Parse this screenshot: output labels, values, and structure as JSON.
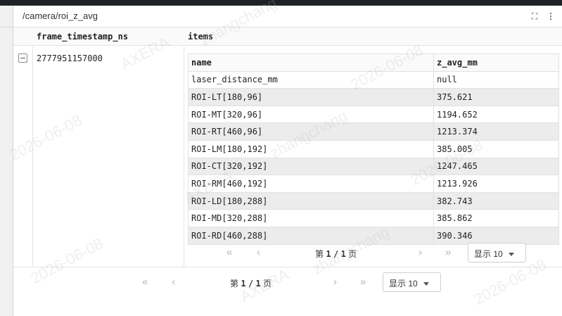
{
  "panel": {
    "title": "/camera/roi_z_avg"
  },
  "outer_table": {
    "columns": [
      "frame_timestamp_ns",
      "items"
    ],
    "row": {
      "frame_timestamp_ns": "2777951157000"
    }
  },
  "inner_table": {
    "columns": [
      "name",
      "z_avg_mm"
    ],
    "rows": [
      [
        "laser_distance_mm",
        "null"
      ],
      [
        "ROI-LT[180,96]",
        "375.621"
      ],
      [
        "ROI-MT[320,96]",
        "1194.652"
      ],
      [
        "ROI-RT[460,96]",
        "1213.374"
      ],
      [
        "ROI-LM[180,192]",
        "385.005"
      ],
      [
        "ROI-CT[320,192]",
        "1247.465"
      ],
      [
        "ROI-RM[460,192]",
        "1213.926"
      ],
      [
        "ROI-LD[180,288]",
        "382.743"
      ],
      [
        "ROI-MD[320,288]",
        "385.862"
      ],
      [
        "ROI-RD[460,288]",
        "390.346"
      ]
    ]
  },
  "inner_pager": {
    "prefix": "第",
    "current": "1",
    "sep": "/",
    "total": "1",
    "suffix": "页",
    "page_size": "显示 10"
  },
  "outer_pager": {
    "prefix": "第",
    "current": "1",
    "sep": "/",
    "total": "1",
    "suffix": "页",
    "page_size": "显示 10"
  },
  "icons": {
    "first": "«",
    "prev": "‹",
    "next": "›",
    "last": "»",
    "expand": "⛶",
    "menu": "⋮"
  },
  "watermarks": [
    "AXERA",
    "zhangchang",
    "2026-06-08"
  ]
}
